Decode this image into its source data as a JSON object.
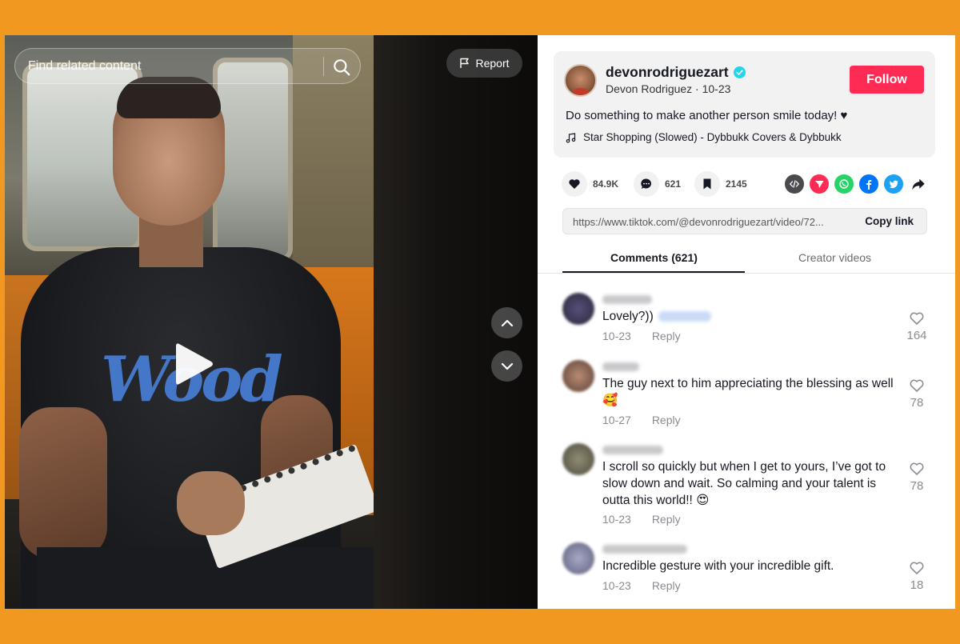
{
  "search": {
    "placeholder": "Find related content"
  },
  "video": {
    "report_label": "Report",
    "shirt_text": "Wood"
  },
  "creator": {
    "username": "devonrodriguezart",
    "display_name": "Devon Rodriguez",
    "date": "10-23",
    "subline": "Devon Rodriguez · 10-23",
    "follow_label": "Follow",
    "caption": "Do something to make another person smile today! ♥",
    "music": "Star Shopping (Slowed) - Dybbukk Covers & Dybbukk"
  },
  "stats": {
    "likes": "84.9K",
    "comments": "621",
    "saves": "2145"
  },
  "share_icons": [
    {
      "icon": "embed-icon",
      "color": "#4a4a4e"
    },
    {
      "icon": "send-icon",
      "color": "#fe2c55"
    },
    {
      "icon": "whatsapp-icon",
      "color": "#25d366"
    },
    {
      "icon": "facebook-icon",
      "color": "#0075fa"
    },
    {
      "icon": "twitter-icon",
      "color": "#1da1f2"
    },
    {
      "icon": "share-arrow-icon",
      "color": "#161823"
    }
  ],
  "link": {
    "url": "https://www.tiktok.com/@devonrodriguezart/video/72...",
    "copy_label": "Copy link"
  },
  "tabs": {
    "comments": "Comments (621)",
    "creator": "Creator videos"
  },
  "comments": [
    {
      "text": "Lovely?))",
      "date": "10-23",
      "reply": "Reply",
      "likes": "164"
    },
    {
      "text": "The guy next to him appreciating the blessing as well 🥰",
      "date": "10-27",
      "reply": "Reply",
      "likes": "78"
    },
    {
      "text": "I scroll so quickly but when I get to yours, I’ve got to slow down and wait. So calming and your talent is outta this world!! 😍",
      "date": "10-23",
      "reply": "Reply",
      "likes": "78"
    },
    {
      "text": "Incredible gesture with your incredible gift.",
      "date": "10-23",
      "reply": "Reply",
      "likes": "18"
    }
  ],
  "colors": {
    "accent": "#fe2c55",
    "verified": "#20d5ec",
    "frame": "#F0981F"
  }
}
